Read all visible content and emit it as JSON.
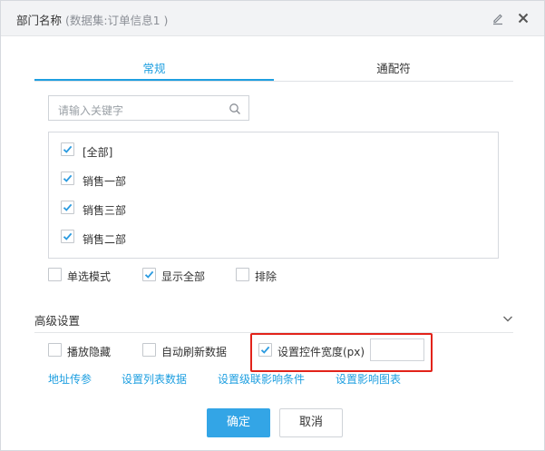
{
  "dialog": {
    "title": "部门名称",
    "subtitle": "(数据集:订单信息1 )"
  },
  "tabs": [
    {
      "label": "常规",
      "active": true
    },
    {
      "label": "通配符",
      "active": false
    }
  ],
  "search": {
    "placeholder": "请输入关键字"
  },
  "list": {
    "items": [
      {
        "label": "[全部]",
        "checked": true
      },
      {
        "label": "销售一部",
        "checked": true
      },
      {
        "label": "销售三部",
        "checked": true
      },
      {
        "label": "销售二部",
        "checked": true
      }
    ]
  },
  "options": {
    "single_select": {
      "label": "单选模式",
      "checked": false
    },
    "show_all": {
      "label": "显示全部",
      "checked": true
    },
    "exclude": {
      "label": "排除",
      "checked": false
    }
  },
  "advanced": {
    "title": "高级设置",
    "hide_on_play": {
      "label": "播放隐藏",
      "checked": false
    },
    "auto_refresh": {
      "label": "自动刷新数据",
      "checked": false
    },
    "set_width": {
      "label": "设置控件宽度(px)",
      "checked": true
    },
    "width_value": "",
    "links": {
      "address_pass": "地址传参",
      "set_list_data": "设置列表数据",
      "set_cascade": "设置级联影响条件",
      "set_affect_chart": "设置影响图表"
    }
  },
  "buttons": {
    "ok": "确定",
    "cancel": "取消"
  },
  "colors": {
    "accent": "#1e9fe0",
    "ok_button": "#33a5e6",
    "highlight_border": "#e2231a"
  }
}
